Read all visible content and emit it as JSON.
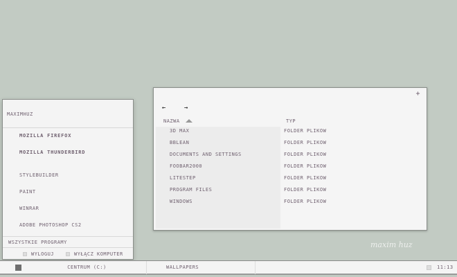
{
  "start_menu": {
    "user": "maximhuz",
    "pinned": [
      "Mozilla Firefox",
      "Mozilla Thunderbird"
    ],
    "recent": [
      "Stylebuilder",
      "Paint",
      "WinRAR",
      "Adobe Photoshop CS2"
    ],
    "all_programs": "Wszystkie programy",
    "logoff": "Wyloguj",
    "shutdown": "Wyłącz komputer"
  },
  "taskbar": {
    "tasks": [
      "Centrum (C:)",
      "Wallpapers"
    ],
    "clock": "11:13"
  },
  "explorer": {
    "add": "+",
    "back": "←",
    "forward": "→",
    "col_name": "Nazwa",
    "col_type": "Typ",
    "rows": [
      {
        "name": "3D Max",
        "type": "Folder plikow"
      },
      {
        "name": "bbLean",
        "type": "Folder plikow"
      },
      {
        "name": "Documents and Settings",
        "type": "Folder plikow"
      },
      {
        "name": "foobar2000",
        "type": "Folder plikow"
      },
      {
        "name": "LiteStep",
        "type": "Folder plikow"
      },
      {
        "name": "Program Files",
        "type": "Folder plikow"
      },
      {
        "name": "WINDOWS",
        "type": "Folder plikow"
      }
    ]
  },
  "watermark": "maximhuz"
}
